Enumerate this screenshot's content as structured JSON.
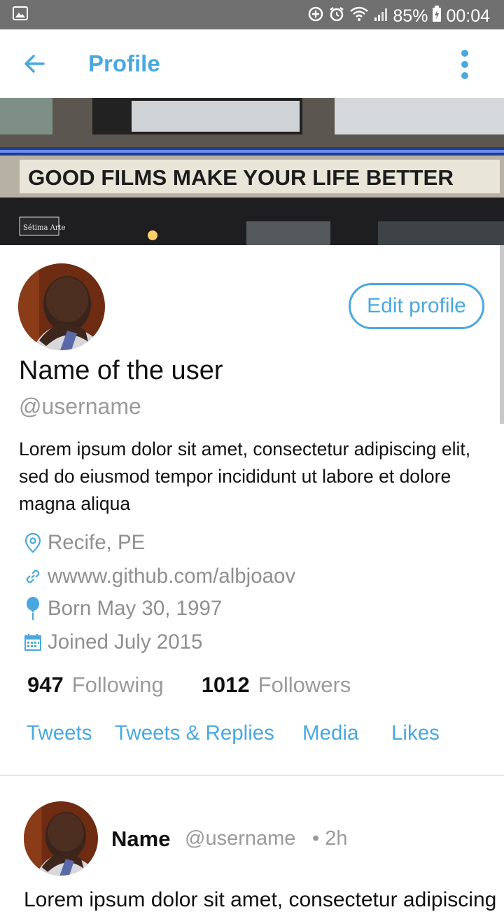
{
  "status_bar": {
    "battery": "85%",
    "time": "00:04"
  },
  "app_bar": {
    "title": "Profile"
  },
  "banner": {
    "sign_text": "GOOD FILMS MAKE YOUR LIFE BETTER",
    "small_sign_text": "Sétima Arte"
  },
  "profile": {
    "edit_button": "Edit profile",
    "name": "Name of the user",
    "handle": "@username",
    "bio": "Lorem ipsum dolor sit amet, consectetur adipiscing elit, sed do eiusmod tempor incididunt ut labore et dolore magna aliqua",
    "location": "Recife, PE",
    "website": "wwww.github.com/albjoaov",
    "birthday": "Born May 30, 1997",
    "joined": "Joined July 2015",
    "following_count": "947",
    "following_label": "Following",
    "followers_count": "1012",
    "followers_label": "Followers"
  },
  "tabs": [
    "Tweets",
    "Tweets & Replies",
    "Media",
    "Likes"
  ],
  "tweet": {
    "name": "Name",
    "handle": "@username",
    "time": "• 2h",
    "body": "Lorem ipsum dolor sit amet, consectetur adipiscing"
  },
  "colors": {
    "accent": "#4aa8e0",
    "status_bar": "#707070",
    "muted_text": "#9a9a9a"
  },
  "icons": {
    "location": "map-pin-icon",
    "website": "link-icon",
    "birthday": "balloon-icon",
    "joined": "calendar-icon"
  }
}
